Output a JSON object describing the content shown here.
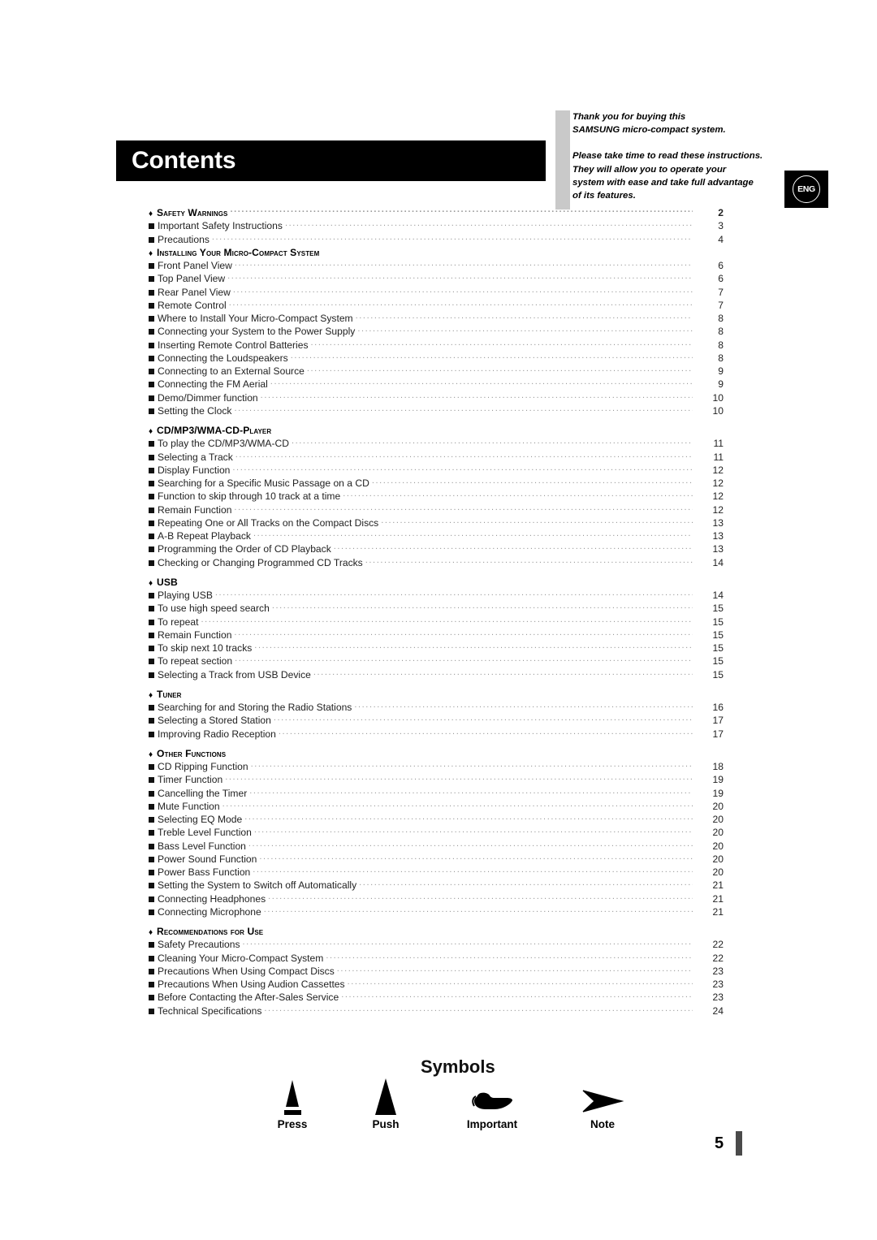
{
  "header": {
    "title": "Contents",
    "language_badge": "ENG"
  },
  "thanks": {
    "paragraph1": [
      "Thank you for buying this",
      "SAMSUNG micro-compact system."
    ],
    "paragraph2": [
      "Please take time to read these instructions.",
      "They will allow you to operate your",
      "system with ease and take full advantage",
      "of its features."
    ]
  },
  "toc": [
    {
      "type": "section",
      "label": "Safety Warnings",
      "page": "2"
    },
    {
      "type": "item",
      "label": "Important Safety Instructions",
      "page": "3"
    },
    {
      "type": "item",
      "label": "Precautions",
      "page": "4"
    },
    {
      "type": "section",
      "label": "Installing Your Micro-Compact System",
      "page": ""
    },
    {
      "type": "item",
      "label": "Front Panel View",
      "page": "6"
    },
    {
      "type": "item",
      "label": "Top Panel View",
      "page": "6"
    },
    {
      "type": "item",
      "label": "Rear Panel View",
      "page": "7"
    },
    {
      "type": "item",
      "label": "Remote Control",
      "page": "7"
    },
    {
      "type": "item",
      "label": "Where to Install Your Micro-Compact System",
      "page": "8"
    },
    {
      "type": "item",
      "label": "Connecting your System to the Power Supply",
      "page": "8"
    },
    {
      "type": "item",
      "label": "Inserting Remote Control Batteries",
      "page": "8"
    },
    {
      "type": "item",
      "label": "Connecting the Loudspeakers",
      "page": "8"
    },
    {
      "type": "item",
      "label": "Connecting to an External Source",
      "page": "9"
    },
    {
      "type": "item",
      "label": "Connecting the FM Aerial",
      "page": "9"
    },
    {
      "type": "item",
      "label": "Demo/Dimmer function",
      "page": "10"
    },
    {
      "type": "item",
      "label": "Setting the Clock",
      "page": "10"
    },
    {
      "type": "spacer"
    },
    {
      "type": "section",
      "label": "CD/MP3/WMA-CD-Player",
      "page": ""
    },
    {
      "type": "item",
      "label": "To play the CD/MP3/WMA-CD",
      "page": "11"
    },
    {
      "type": "item",
      "label": "Selecting a Track",
      "page": "11"
    },
    {
      "type": "item",
      "label": "Display Function",
      "page": "12"
    },
    {
      "type": "item",
      "label": "Searching for a Specific Music Passage on a CD",
      "page": "12"
    },
    {
      "type": "item",
      "label": "Function to skip through 10 track at a time",
      "page": "12"
    },
    {
      "type": "item",
      "label": "Remain Function",
      "page": "12"
    },
    {
      "type": "item",
      "label": "Repeating One or All Tracks on the Compact Discs",
      "page": "13"
    },
    {
      "type": "item",
      "label": "A-B Repeat Playback",
      "page": "13"
    },
    {
      "type": "item",
      "label": "Programming the Order of CD Playback",
      "page": "13"
    },
    {
      "type": "item",
      "label": "Checking or Changing Programmed CD Tracks",
      "page": "14"
    },
    {
      "type": "spacer"
    },
    {
      "type": "section",
      "label": "USB",
      "page": ""
    },
    {
      "type": "item",
      "label": "Playing USB",
      "page": "14"
    },
    {
      "type": "item",
      "label": "To use high speed search",
      "page": "15"
    },
    {
      "type": "item",
      "label": "To repeat",
      "page": "15"
    },
    {
      "type": "item",
      "label": "Remain Function",
      "page": "15"
    },
    {
      "type": "item",
      "label": "To skip next 10 tracks",
      "page": "15"
    },
    {
      "type": "item",
      "label": "To repeat section",
      "page": "15"
    },
    {
      "type": "item",
      "label": "Selecting a Track from USB Device",
      "page": "15"
    },
    {
      "type": "spacer"
    },
    {
      "type": "section",
      "label": "Tuner",
      "page": ""
    },
    {
      "type": "item",
      "label": "Searching for and Storing the Radio Stations",
      "page": "16"
    },
    {
      "type": "item",
      "label": "Selecting a Stored Station",
      "page": "17"
    },
    {
      "type": "item",
      "label": " Improving Radio Reception",
      "page": "17"
    },
    {
      "type": "spacer"
    },
    {
      "type": "section",
      "label": "Other Functions",
      "page": ""
    },
    {
      "type": "item",
      "label": "CD Ripping Function",
      "page": "18"
    },
    {
      "type": "item",
      "label": "Timer Function",
      "page": "19"
    },
    {
      "type": "item",
      "label": "Cancelling the Timer",
      "page": "19"
    },
    {
      "type": "item",
      "label": "Mute Function",
      "page": "20"
    },
    {
      "type": "item",
      "label": "Selecting EQ  Mode",
      "page": "20"
    },
    {
      "type": "item",
      "label": "Treble Level Function",
      "page": "20"
    },
    {
      "type": "item",
      "label": "Bass Level Function",
      "page": "20"
    },
    {
      "type": "item",
      "label": "Power Sound Function",
      "page": "20"
    },
    {
      "type": "item",
      "label": "Power Bass Function",
      "page": "20"
    },
    {
      "type": "item",
      "label": "Setting the System to Switch off Automatically",
      "page": "21"
    },
    {
      "type": "item",
      "label": "Connecting Headphones",
      "page": "21"
    },
    {
      "type": "item",
      "label": "Connecting Microphone",
      "page": "21"
    },
    {
      "type": "spacer"
    },
    {
      "type": "section",
      "label": "Recommendations for Use",
      "page": ""
    },
    {
      "type": "item",
      "label": "Safety Precautions",
      "page": "22"
    },
    {
      "type": "item",
      "label": "Cleaning Your Micro-Compact System",
      "page": "22"
    },
    {
      "type": "item",
      "label": "Precautions When Using Compact Discs",
      "page": "23"
    },
    {
      "type": "item",
      "label": "Precautions When Using Audion Cassettes",
      "page": "23"
    },
    {
      "type": "item",
      "label": "Before Contacting the After-Sales Service",
      "page": "23"
    },
    {
      "type": "item",
      "label": "Technical Specifications",
      "page": "24"
    }
  ],
  "symbols": {
    "title": "Symbols",
    "items": [
      {
        "icon": "press-triangle-bar-icon",
        "caption": "Press"
      },
      {
        "icon": "push-triangle-icon",
        "caption": "Push"
      },
      {
        "icon": "pointing-hand-icon",
        "caption": "Important"
      },
      {
        "icon": "arrowhead-icon",
        "caption": "Note"
      }
    ]
  },
  "footer": {
    "page_number": "5"
  }
}
